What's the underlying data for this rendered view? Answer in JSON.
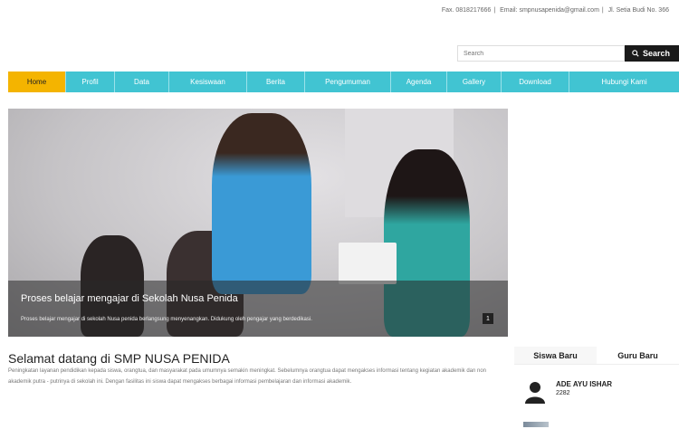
{
  "topbar": {
    "phone": "Fax. 0818217666",
    "email": "Email: smpnusapenida@gmail.com",
    "address": "Jl. Setia Budi No. 366"
  },
  "search": {
    "placeholder": "Search",
    "button_label": "Search"
  },
  "nav": {
    "items": [
      {
        "label": "Home"
      },
      {
        "label": "Profil"
      },
      {
        "label": "Data"
      },
      {
        "label": "Kesiswaan"
      },
      {
        "label": "Berita"
      },
      {
        "label": "Pengumuman"
      },
      {
        "label": "Agenda"
      },
      {
        "label": "Gallery"
      },
      {
        "label": "Download"
      },
      {
        "label": "Hubungi Kami"
      }
    ]
  },
  "hero": {
    "caption_title": "Proses belajar mengajar di Sekolah Nusa Penida",
    "caption_text": "Proses belajar mengajar di sekolah Nusa penida berlangsung menyenangkan. Didukung oleh pengajar yang berdedikasi.",
    "slide_number": "1"
  },
  "welcome": {
    "title": "Selamat datang di SMP NUSA PENIDA",
    "text": "Peningkatan layanan pendidikan kepada siswa, orangtua, dan masyarakat pada umumnya semakin meningkat. Sebelumnya orangtua dapat mengakses informasi tentang kegiatan akademik dan non akademik putra - putrinya di sekolah ini. Dengan fasilitas ini siswa dapat mengakses berbagai informasi pembelajaran dan informasi akademik."
  },
  "sidebar": {
    "tabs": [
      {
        "label": "Siswa Baru"
      },
      {
        "label": "Guru Baru"
      }
    ],
    "person": {
      "name": "ADE AYU ISHAR",
      "id": "2282"
    }
  },
  "colors": {
    "nav_bg": "#41c4d2",
    "nav_active": "#f4b400",
    "search_button": "#1a1a1a"
  }
}
